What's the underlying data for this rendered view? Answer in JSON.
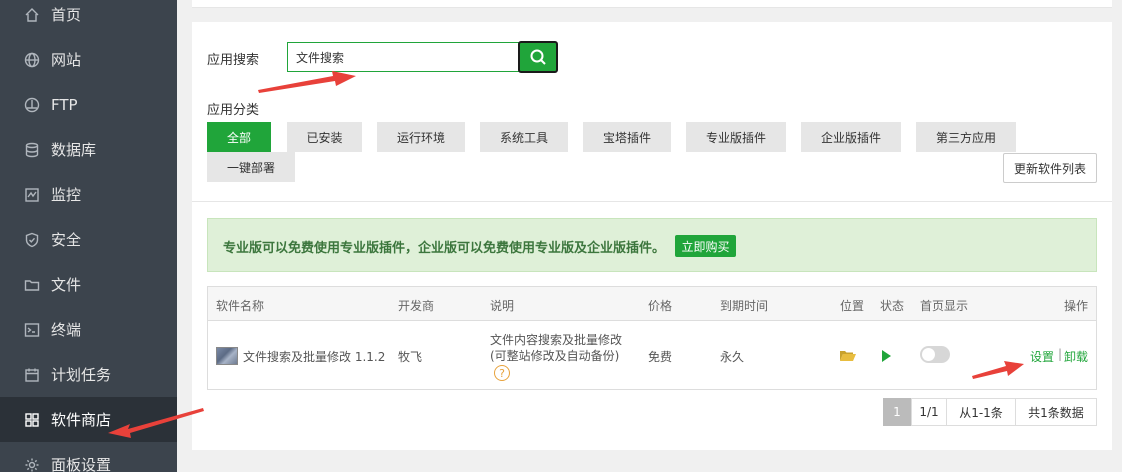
{
  "sidebar": {
    "items": [
      {
        "label": "首页",
        "icon": "home-icon"
      },
      {
        "label": "网站",
        "icon": "globe-icon"
      },
      {
        "label": "FTP",
        "icon": "ftp-icon"
      },
      {
        "label": "数据库",
        "icon": "database-icon"
      },
      {
        "label": "监控",
        "icon": "monitor-icon"
      },
      {
        "label": "安全",
        "icon": "shield-icon"
      },
      {
        "label": "文件",
        "icon": "folder-icon"
      },
      {
        "label": "终端",
        "icon": "terminal-icon"
      },
      {
        "label": "计划任务",
        "icon": "calendar-icon"
      },
      {
        "label": "软件商店",
        "icon": "grid-icon"
      },
      {
        "label": "面板设置",
        "icon": "gear-icon"
      }
    ],
    "active": "软件商店"
  },
  "search": {
    "label": "应用搜索",
    "value": "文件搜索",
    "button_icon": "search-icon"
  },
  "categories": {
    "label": "应用分类",
    "items": [
      "全部",
      "已安装",
      "运行环境",
      "系统工具",
      "宝塔插件",
      "专业版插件",
      "企业版插件",
      "第三方应用",
      "一键部署"
    ],
    "active": "全部",
    "refresh_label": "更新软件列表"
  },
  "notice": {
    "text": "专业版可以免费使用专业版插件，企业版可以免费使用专业版及企业版插件。",
    "buy_label": "立即购买"
  },
  "table": {
    "headers": [
      "软件名称",
      "开发商",
      "说明",
      "价格",
      "到期时间",
      "位置",
      "状态",
      "首页显示",
      "操作"
    ],
    "row": {
      "name": "文件搜索及批量修改 1.1.2",
      "developer": "牧飞",
      "desc_line1": "文件内容搜索及批量修改",
      "desc_line2": "(可整站修改及自动备份)",
      "help": "?",
      "price": "免费",
      "expiry": "永久",
      "location_icon": "folder-open-icon",
      "status_icon": "play-icon",
      "homepage_display": false,
      "op_settings": "设置",
      "op_separator": "|",
      "op_uninstall": "卸载"
    }
  },
  "pagination": {
    "current": "1",
    "pages": "1/1",
    "range": "从1-1条",
    "total": "共1条数据"
  },
  "colors": {
    "accent": "#20a53a",
    "sidebar_bg": "#3c444d",
    "annotation_arrow": "#e8413a"
  }
}
